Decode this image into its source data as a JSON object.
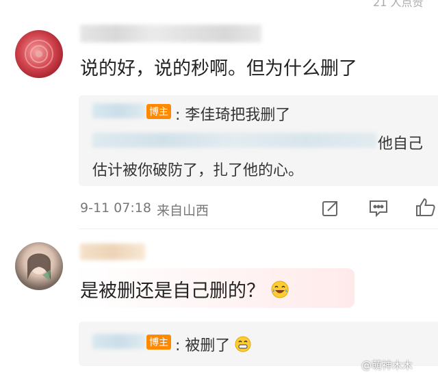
{
  "top": {
    "partial_text": "21 人点赞"
  },
  "comments": [
    {
      "username_blurred": "等等等等等等等",
      "text": "说的好，说的秒啊。但为什么删了",
      "reply": {
        "author_blurred": "·····",
        "badge": "博主",
        "line1": ": 李佳琦把我删了",
        "line2_blurred": "····················",
        "line2_tail": "他自己",
        "line3": "估计被你破防了，扎了他的心。"
      },
      "time": "9-11 07:18",
      "location": "来自山西"
    },
    {
      "username_blurred": "···",
      "text": "是被删还是自己删的？",
      "reply": {
        "author_blurred": "····",
        "badge": "博主",
        "line1": ": 被删了"
      }
    }
  ],
  "watermark": "@萌神木木",
  "icons": [
    "share-icon",
    "comment-icon",
    "like-icon"
  ],
  "colors": {
    "badge": "#ff8a00",
    "card": "#f5f5f5",
    "meta": "#777777"
  }
}
